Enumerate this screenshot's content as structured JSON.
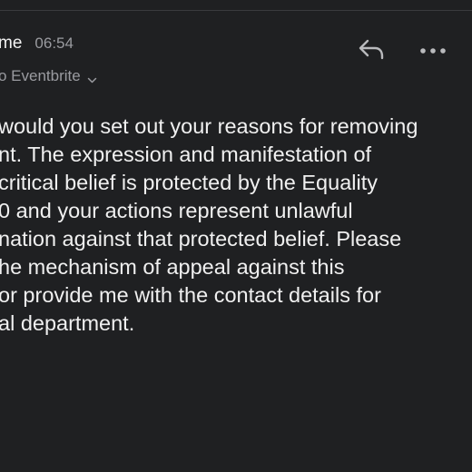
{
  "header": {
    "sender_name": "me",
    "time": "06:54",
    "recipient": "o Eventbrite",
    "recipient_icon": "chevron-down-icon",
    "reply_icon": "reply-icon",
    "more_icon": "more-icon"
  },
  "message": {
    "lines": [
      "would you set out your reasons for removing",
      "nt. The expression and manifestation of",
      "critical belief is protected by the Equality",
      "0 and your actions represent unlawful",
      "nation against that protected belief. Please",
      "he mechanism of appeal against this",
      " or provide me with the contact details for",
      "al department."
    ]
  },
  "colors": {
    "background": "#1f2022",
    "text": "#f0f0f0",
    "secondary_text": "#9a9ba0",
    "icon": "#b9babd"
  }
}
